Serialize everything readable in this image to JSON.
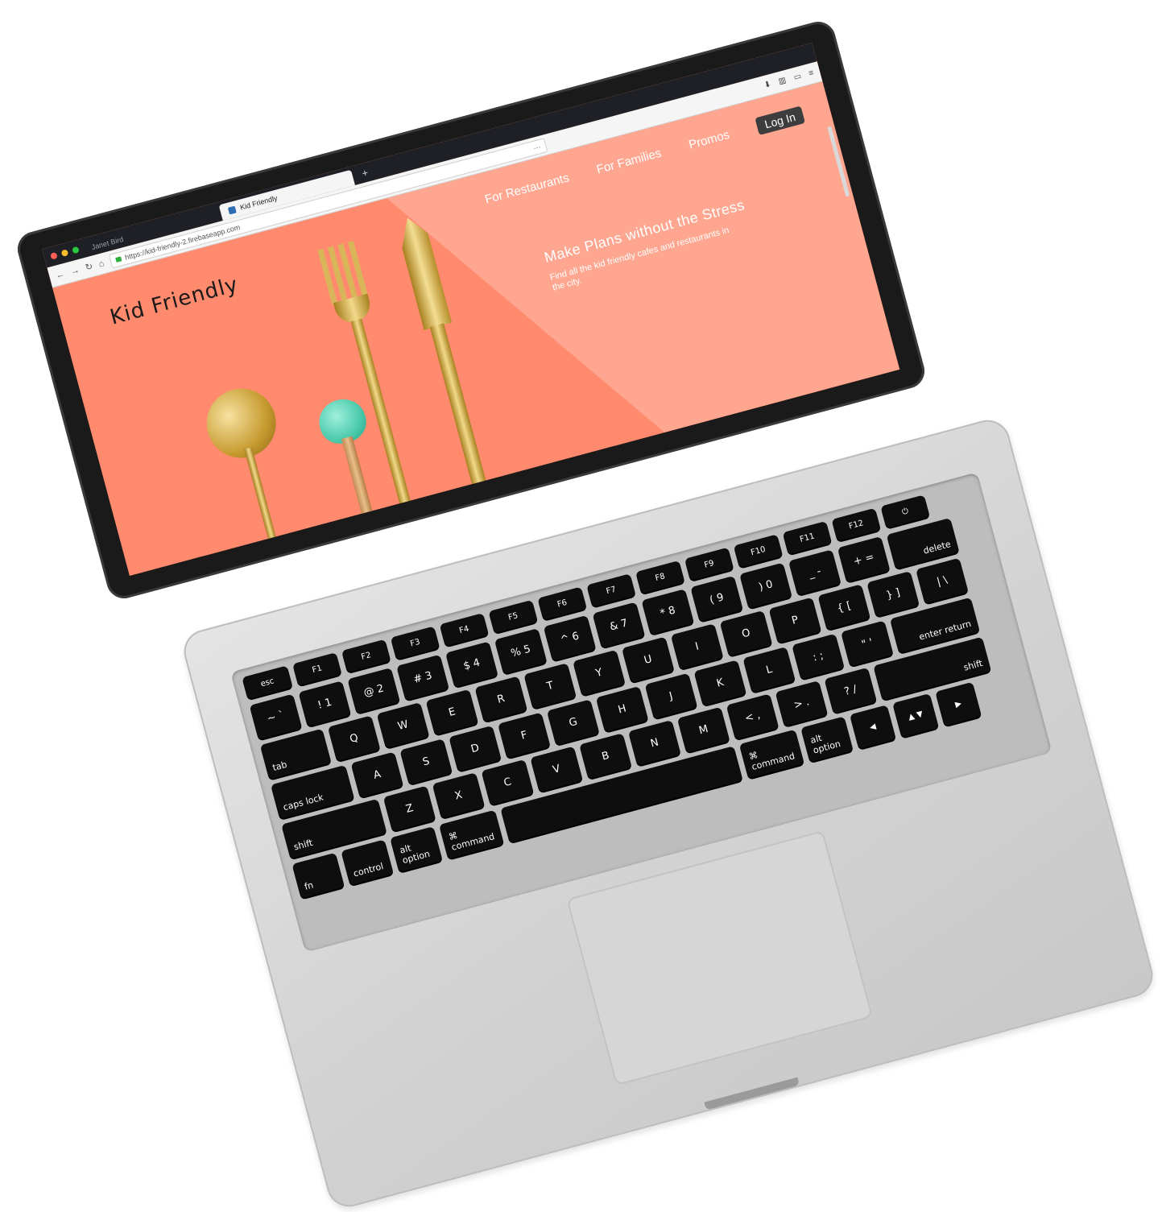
{
  "browser": {
    "background_tab_label": "Janet Bird",
    "active_tab_label": "Kid Friendly",
    "new_tab_symbol": "+",
    "url": "https://kid-friendly-2.firebaseapp.com",
    "nav_back": "←",
    "nav_forward": "→",
    "nav_reload": "↻",
    "nav_home": "⌂",
    "page_actions": "···"
  },
  "site": {
    "brand": "Kid Friendly",
    "nav": {
      "restaurants": "For Restaurants",
      "families": "For Families",
      "promos": "Promos",
      "login": "Log In"
    },
    "hero": {
      "title": "Make Plans without the Stress",
      "subtitle": "Find all the kid friendly cafes and restaurants in the city."
    },
    "colors": {
      "background": "#ff8a6d",
      "overlay": "#ffa690",
      "login_button": "#3d3d3d"
    }
  },
  "keyboard": {
    "row_fn": [
      "esc",
      "F1",
      "F2",
      "F3",
      "F4",
      "F5",
      "F6",
      "F7",
      "F8",
      "F9",
      "F10",
      "F11",
      "F12",
      "⏻"
    ],
    "row_num": [
      "~ `",
      "! 1",
      "@ 2",
      "# 3",
      "$ 4",
      "% 5",
      "^ 6",
      "& 7",
      "* 8",
      "( 9",
      ") 0",
      "_ -",
      "+ =",
      "delete"
    ],
    "row_qwerty": [
      "tab",
      "Q",
      "W",
      "E",
      "R",
      "T",
      "Y",
      "U",
      "I",
      "O",
      "P",
      "{ [",
      "} ]",
      "| \\"
    ],
    "row_asdf": [
      "caps lock",
      "A",
      "S",
      "D",
      "F",
      "G",
      "H",
      "J",
      "K",
      "L",
      ": ;",
      "\" '",
      "enter return"
    ],
    "row_zxcv": [
      "shift",
      "Z",
      "X",
      "C",
      "V",
      "B",
      "N",
      "M",
      "< ,",
      "> .",
      "? /",
      "shift"
    ],
    "row_bottom": [
      "fn",
      "control",
      "alt option",
      "⌘ command",
      "",
      "⌘ command",
      "alt option",
      "◀",
      "▲ ▼",
      "▶"
    ]
  }
}
